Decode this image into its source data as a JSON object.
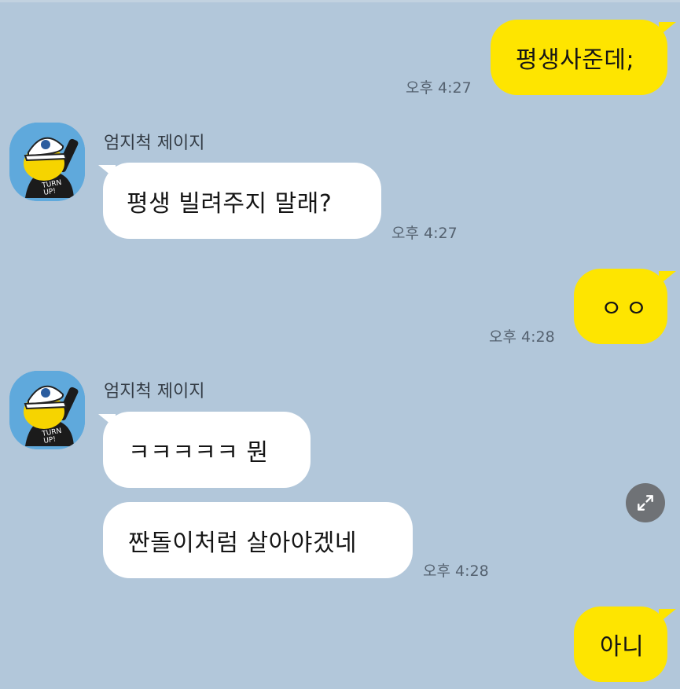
{
  "chat": {
    "messages": [
      {
        "text": "평생사준데;",
        "time": "오후 4:27"
      },
      {
        "sender": "엄지척 제이지",
        "text": "평생 빌려주지 말래?",
        "time": "오후 4:27"
      },
      {
        "text": "ㅇㅇ",
        "time": "오후 4:28"
      },
      {
        "sender": "엄지척 제이지",
        "text": "ㅋㅋㅋㅋㅋ 뭔"
      },
      {
        "text": "짠돌이처럼 살아야겠네",
        "time": "오후 4:28"
      },
      {
        "text": "아니"
      }
    ]
  },
  "colors": {
    "background": "#b2c7da",
    "my_bubble": "#fee500",
    "their_bubble": "#ffffff",
    "avatar_bg": "#5fa9dc"
  },
  "icons": {
    "avatar": "profile-avatar-icon",
    "expand": "expand-arrows-icon"
  }
}
